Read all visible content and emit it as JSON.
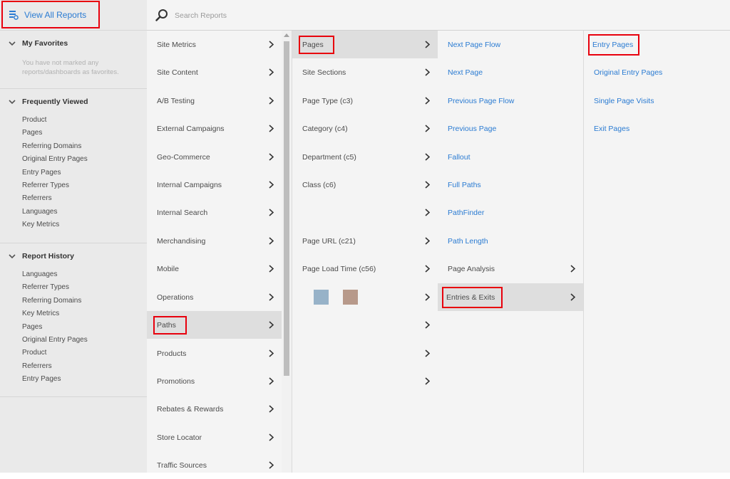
{
  "sidebar": {
    "view_all_reports": "View All Reports",
    "favorites": {
      "title": "My Favorites",
      "empty_message": "You have not marked any reports/dashboards as favorites."
    },
    "frequently_viewed": {
      "title": "Frequently Viewed",
      "items": [
        "Product",
        "Pages",
        "Referring Domains",
        "Original Entry Pages",
        "Entry Pages",
        "Referrer Types",
        "Referrers",
        "Languages",
        "Key Metrics"
      ]
    },
    "report_history": {
      "title": "Report History",
      "items": [
        "Languages",
        "Referrer Types",
        "Referring Domains",
        "Key Metrics",
        "Pages",
        "Original Entry Pages",
        "Product",
        "Referrers",
        "Entry Pages"
      ]
    }
  },
  "search": {
    "placeholder": "Search Reports",
    "value": ""
  },
  "columns": {
    "col1": [
      "Site Metrics",
      "Site Content",
      "A/B Testing",
      "External Campaigns",
      "Geo-Commerce",
      "Internal Campaigns",
      "Internal Search",
      "Merchandising",
      "Mobile",
      "Operations",
      "Paths",
      "Products",
      "Promotions",
      "Rebates & Rewards",
      "Store Locator",
      "Traffic Sources"
    ],
    "col1_selected": "Paths",
    "col2": [
      "Pages",
      "Site Sections",
      "Page Type (c3)",
      "Category (c4)",
      "Department (c5)",
      "Class (c6)",
      "",
      "Page URL (c21)",
      "Page Load Time (c56)",
      "",
      "",
      "",
      ""
    ],
    "col2_selected": "Pages",
    "col3": [
      "Next Page Flow",
      "Next Page",
      "Previous Page Flow",
      "Previous Page",
      "Fallout",
      "Full Paths",
      "PathFinder",
      "Path Length",
      "Page Analysis",
      "Entries & Exits"
    ],
    "col3_selected": "Entries & Exits",
    "col4": [
      "Entry Pages",
      "Original Entry Pages",
      "Single Page Visits",
      "Exit Pages"
    ]
  },
  "colors": {
    "link": "#2a7bd2",
    "highlight": "#e8000d",
    "swatch_blue": "#97b2c8",
    "swatch_brown": "#b7998a"
  }
}
